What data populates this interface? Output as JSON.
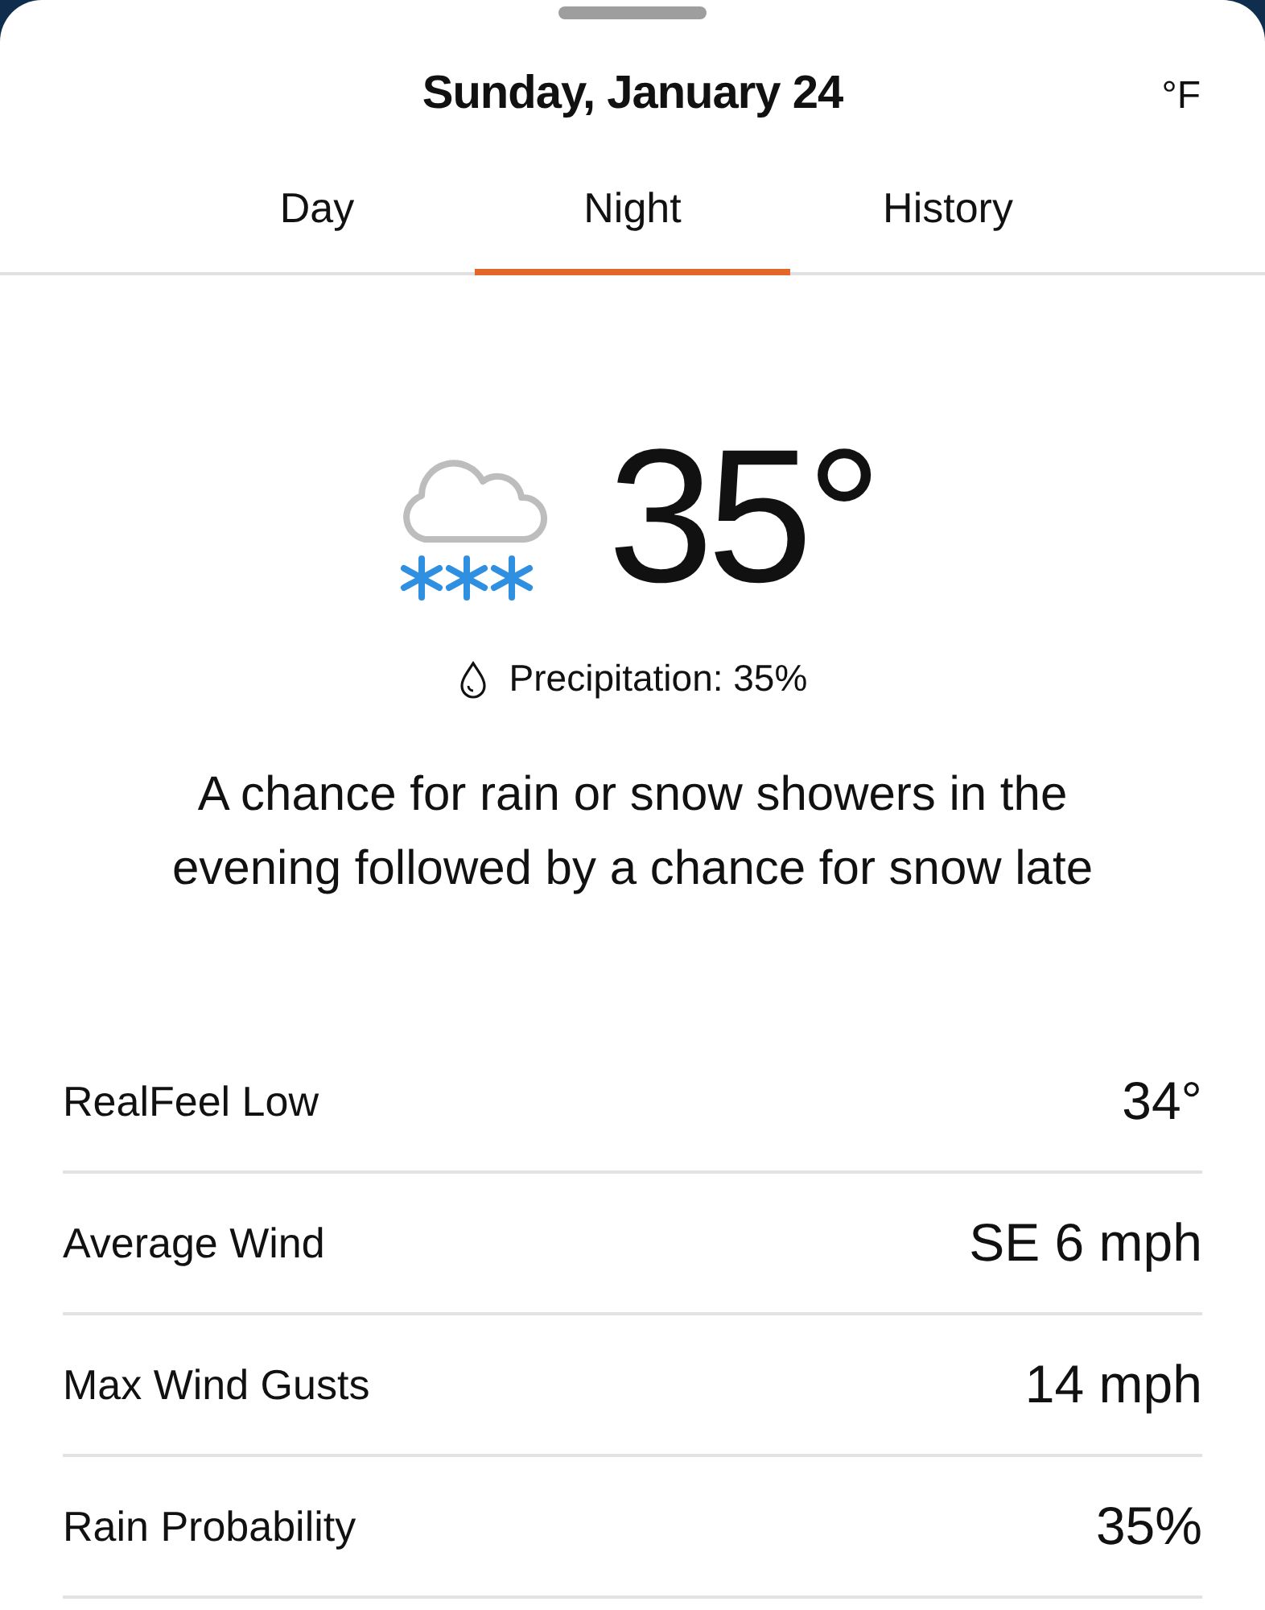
{
  "header": {
    "title": "Sunday, January 24",
    "unit": "°F"
  },
  "tabs": [
    {
      "label": "Day",
      "selected": false
    },
    {
      "label": "Night",
      "selected": true
    },
    {
      "label": "History",
      "selected": false
    }
  ],
  "current": {
    "temperature": "35°",
    "precipitation": "Precipitation: 35%",
    "description": "A chance for rain or snow showers in the evening followed by a chance for snow late"
  },
  "details": [
    {
      "label": "RealFeel Low",
      "value": "34°"
    },
    {
      "label": "Average Wind",
      "value": "SE 6 mph"
    },
    {
      "label": "Max Wind Gusts",
      "value": "14 mph"
    },
    {
      "label": "Rain Probability",
      "value": "35%"
    }
  ]
}
